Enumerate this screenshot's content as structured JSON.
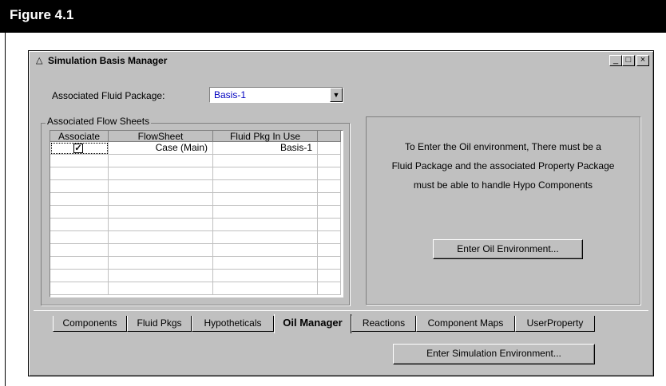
{
  "figure": {
    "title": "Figure 4.1"
  },
  "window": {
    "title": "Simulation Basis Manager",
    "icon": "flask-icon",
    "controls": [
      "_",
      "□",
      "×"
    ]
  },
  "fluid_package": {
    "label": "Associated Fluid Package:",
    "value": "Basis-1"
  },
  "flowsheets": {
    "caption": "Associated Flow Sheets",
    "columns": [
      "Associate",
      "FlowSheet",
      "Fluid Pkg In Use"
    ],
    "rows": [
      {
        "associate": true,
        "flowsheet": "Case (Main)",
        "fluid_pkg": "Basis-1"
      }
    ]
  },
  "info": {
    "lines": [
      "To Enter the Oil environment,  There must be a",
      "Fluid Package and  the associated Property Package",
      "must be able to handle Hypo Components"
    ],
    "button": "Enter Oil Environment..."
  },
  "tabs": [
    "Components",
    "Fluid Pkgs",
    "Hypotheticals",
    "Oil Manager",
    "Reactions",
    "Component Maps",
    "UserProperty"
  ],
  "active_tab": "Oil Manager",
  "enter_sim_button": "Enter Simulation Environment...",
  "colors": {
    "window": "#c0c0c0",
    "combo_text": "#0000c0"
  }
}
